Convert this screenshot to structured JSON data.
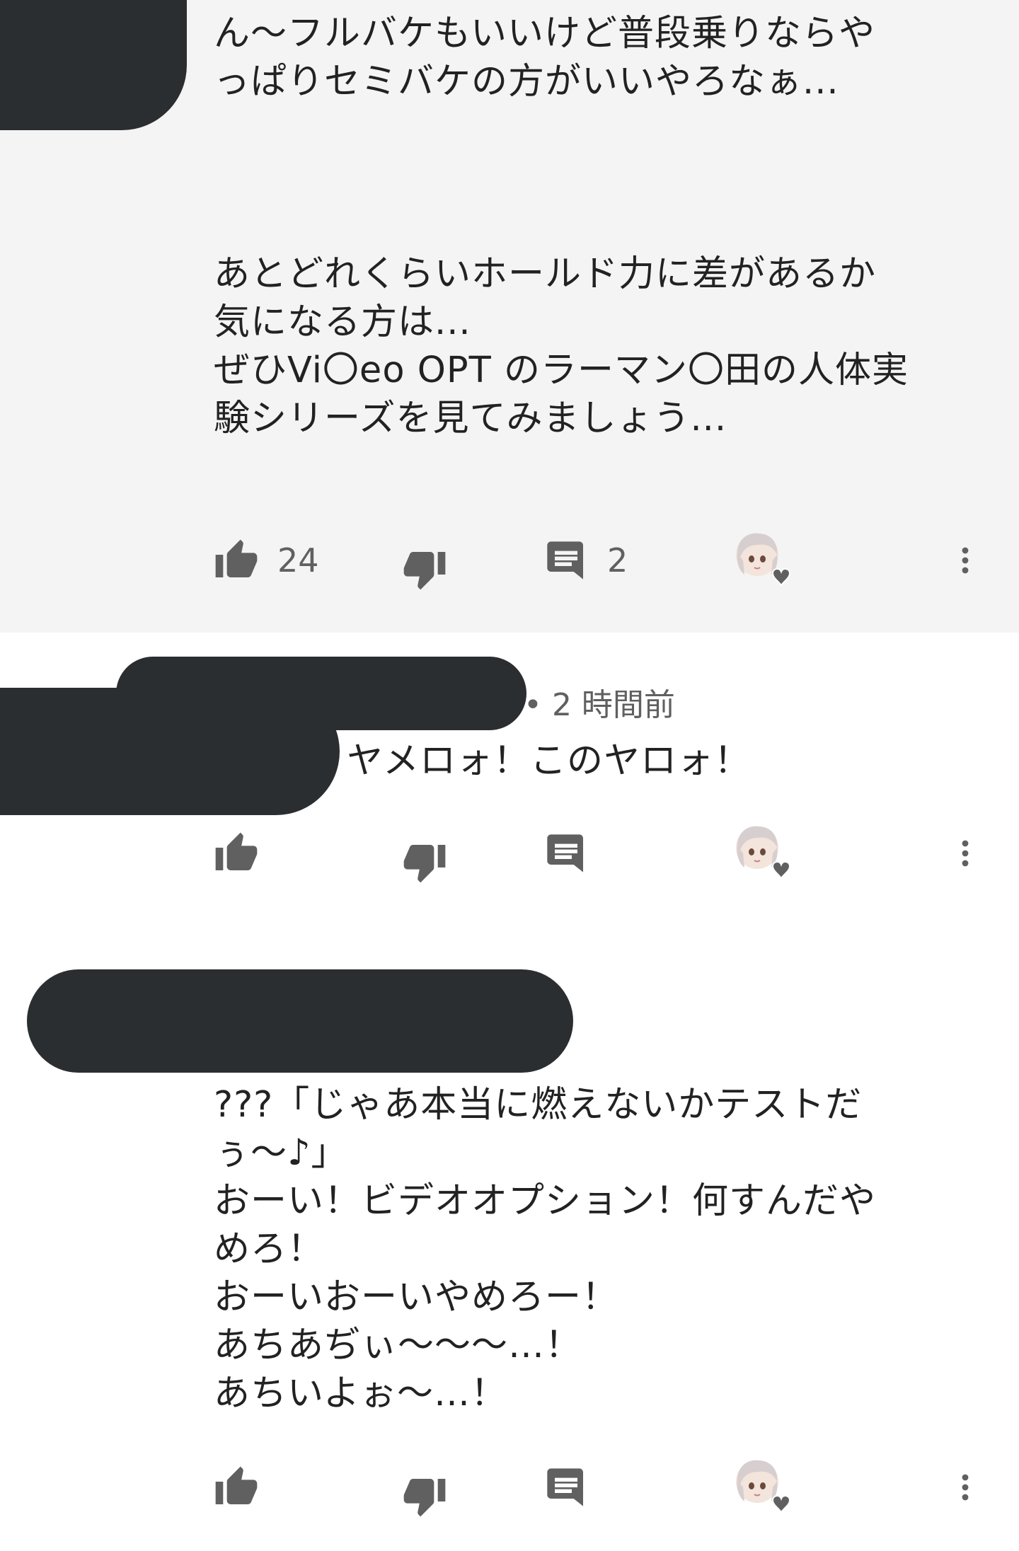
{
  "comments": [
    {
      "text_lines": [
        "ん〜フルバケもいいけど普段乗りならや",
        "っぱりセミバケの方がいいやろなぁ...",
        "",
        "",
        "",
        "あとどれくらいホールド力に差があるか",
        "気になる方は...",
        "ぜひVi〇eo OPT のラーマン〇田の人体実",
        "験シリーズを見てみましょう..."
      ],
      "like_count": "24",
      "reply_count": "2"
    },
    {
      "timestamp": "2 時間前",
      "text_lines": [
        "ヤメロォ！このヤロォ！"
      ]
    },
    {
      "text_lines": [
        "???「じゃあ本当に燃えないかテストだ",
        "ぅ〜♪」",
        "おーい！ビデオオプション！何すんだや",
        "めろ！",
        "おーいおーいやめろー！",
        "あちあぢぃ〜〜〜…！",
        "あちいよぉ〜…！"
      ]
    }
  ],
  "icons": {
    "like": "thumb-up-icon",
    "dislike": "thumb-down-icon",
    "reply": "reply-comment-icon",
    "creator_heart": "creator-heart-icon",
    "more": "more-vert-icon"
  },
  "colors": {
    "highlighted_background": "#f4f4f4",
    "icon_gray": "#606060",
    "redaction": "#2b2e31"
  }
}
